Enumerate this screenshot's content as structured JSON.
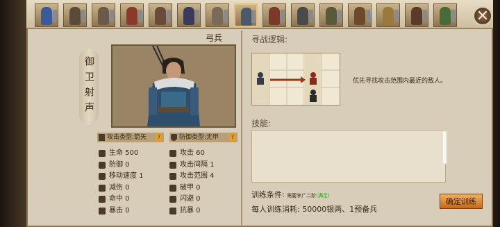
{
  "roster": [
    {
      "color": "#3a5a9a",
      "tag": "A"
    },
    {
      "color": "#5a4a3a",
      "tag": "B"
    },
    {
      "color": "#6a5a4a",
      "tag": "C"
    },
    {
      "color": "#8a3a2a",
      "tag": "D"
    },
    {
      "color": "#6a4a3a",
      "tag": "E"
    },
    {
      "color": "#3a3a5a",
      "tag": "F"
    },
    {
      "color": "#7a6a5a",
      "tag": "G"
    },
    {
      "color": "#4a5a6a",
      "tag": "H"
    },
    {
      "color": "#7a3a2a",
      "tag": "I"
    },
    {
      "color": "#4a4a4a",
      "tag": "J"
    },
    {
      "color": "#5a5a3a",
      "tag": "K"
    },
    {
      "color": "#6a4a2a",
      "tag": "L"
    },
    {
      "color": "#9a7a3a",
      "tag": "M"
    },
    {
      "color": "#5a3a2a",
      "tag": "N"
    },
    {
      "color": "#4a6a3a",
      "tag": "O"
    }
  ],
  "selected_index": 7,
  "unit": {
    "vertical_name": "御卫射声",
    "type_name": "弓兵",
    "attack_type": "攻击类型:箭矢",
    "defense_type": "防御类型:无甲"
  },
  "stats_left": [
    {
      "label": "生命 500",
      "icon": "heart-icon"
    },
    {
      "label": "防御 0",
      "icon": "shield-icon"
    },
    {
      "label": "移动速度 1",
      "icon": "boot-icon"
    },
    {
      "label": "减伤 0",
      "icon": "reduction-icon"
    },
    {
      "label": "命中 0",
      "icon": "target-icon"
    },
    {
      "label": "暴击 0",
      "icon": "crit-icon"
    }
  ],
  "stats_right": [
    {
      "label": "攻击 60",
      "icon": "sword-icon"
    },
    {
      "label": "攻击间隔 1",
      "icon": "interval-icon"
    },
    {
      "label": "攻击范围 4",
      "icon": "range-icon"
    },
    {
      "label": "破甲 0",
      "icon": "pierce-icon"
    },
    {
      "label": "闪避 0",
      "icon": "dodge-icon"
    },
    {
      "label": "抗暴 0",
      "icon": "anticrit-icon"
    }
  ],
  "logic": {
    "title": "寻战逻辑:",
    "description": "优先寻找攻击范围内最近的敌人。"
  },
  "skills": {
    "title": "技能:"
  },
  "training": {
    "condition_label": "训练条件:",
    "condition_req": "需要李广二阶",
    "condition_status": "(满足)",
    "cost_label": "每人训练消耗:",
    "cost_value": "50000银两、1预备兵",
    "confirm": "确定训练"
  },
  "close_symbol": "✕"
}
